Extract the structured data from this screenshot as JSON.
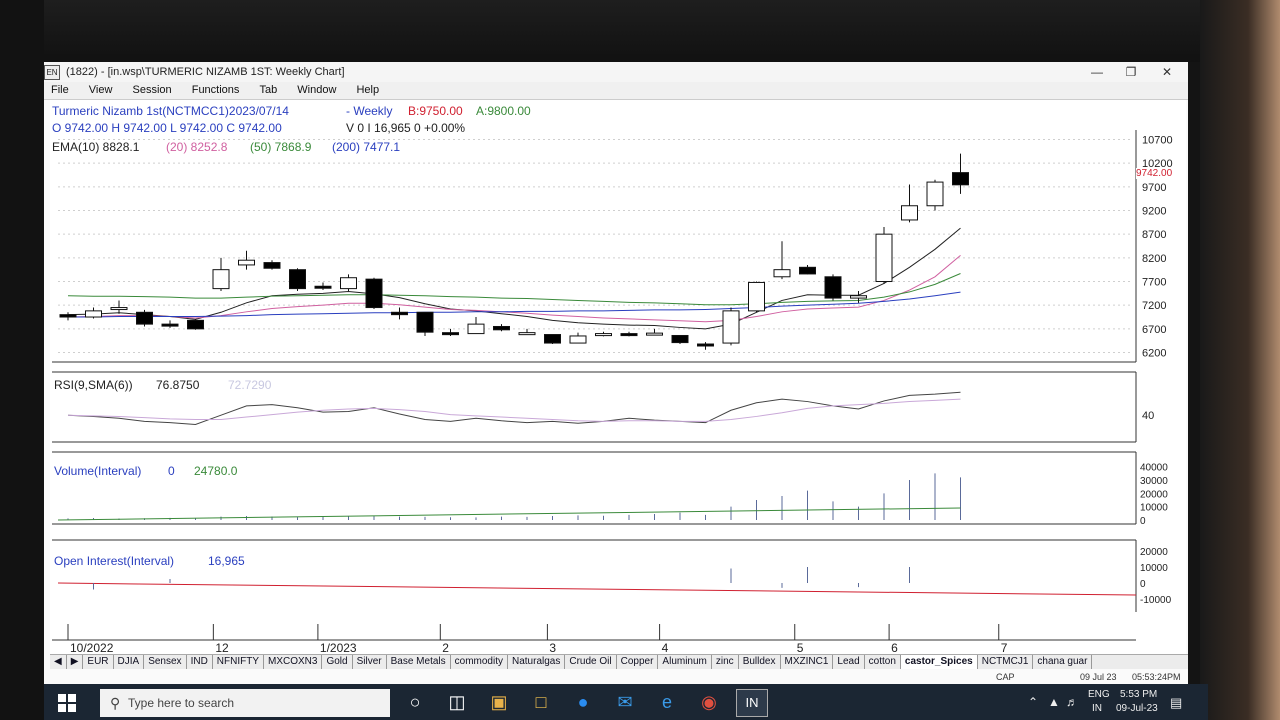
{
  "window": {
    "title": "(1822) - [in.wsp\\TURMERIC NIZAMB 1ST: Weekly Chart]",
    "app_icon_text": "EN",
    "menu": [
      "File",
      "View",
      "Session",
      "Functions",
      "Tab",
      "Window",
      "Help"
    ]
  },
  "quote": {
    "symbol": "Turmeric Nizamb 1st(NCTMCC1)2023/07/14",
    "period": "- Weekly",
    "bid": "B:9750.00",
    "ask": "A:9800.00",
    "ohlc": "O 9742.00 H 9742.00 L 9742.00 C 9742.00",
    "volume_oi": "V 0 I 16,965  0  +0.00%"
  },
  "ema": {
    "label": "EMA(10) 8828.1",
    "e20": "(20) 8252.8",
    "e50": "(50) 7868.9",
    "e200": "(200) 7477.1"
  },
  "panels": {
    "rsi_label": "RSI(9,SMA(6))",
    "rsi_value": "76.8750",
    "rsi_sma": "72.7290",
    "volume_label": "Volume(Interval)",
    "volume_value": "0",
    "volume_avg": "24780.0",
    "oi_label": "Open Interest(Interval)",
    "oi_value": "16,965",
    "last_price_tag": "9742.00"
  },
  "tabs": [
    "EUR",
    "DJIA",
    "Sensex",
    "IND",
    "NFNIFTY",
    "MXCOXN3",
    "Gold",
    "Silver",
    "Base Metals",
    "commodity",
    "Naturalgas",
    "Crude Oil",
    "Copper",
    "Aluminum",
    "zinc",
    "Bulldex",
    "MXZINC1",
    "Lead",
    "cotton",
    "castor_Spices",
    "NCTMCJ1",
    "chana guar"
  ],
  "active_tab": "castor_Spices",
  "status": {
    "cap": "CAP",
    "date": "09 Jul 23",
    "time": "05:53:24PM"
  },
  "taskbar": {
    "search_placeholder": "Type here to search",
    "lang": "ENG",
    "region": "IN",
    "clock_time": "5:53 PM",
    "clock_date": "09-Jul-23"
  },
  "colors": {
    "bull": "#ffffff",
    "bear": "#000000",
    "ema10": "#222222",
    "ema20": "#d060a0",
    "ema50": "#3a8a3a",
    "ema200": "#2a3fbf",
    "rsi": "#444444",
    "accent_red": "#d02030"
  },
  "chart_data": [
    {
      "type": "candlestick",
      "title": "Turmeric Nizamb 1st(NCTMCC1) Weekly",
      "x_labels": [
        "10/2022",
        "12",
        "1/2023",
        "2",
        "3",
        "4",
        "5",
        "6",
        "7"
      ],
      "y_ticks": [
        10700,
        10200,
        9700,
        9200,
        8700,
        8200,
        7700,
        7200,
        6700,
        6200
      ],
      "ylim": [
        6000,
        10900
      ],
      "candles": [
        {
          "o": 7000,
          "h": 7050,
          "l": 6880,
          "c": 6950
        },
        {
          "o": 6950,
          "h": 7150,
          "l": 6920,
          "c": 7080
        },
        {
          "o": 7120,
          "h": 7300,
          "l": 7020,
          "c": 7150
        },
        {
          "o": 7050,
          "h": 7100,
          "l": 6750,
          "c": 6800
        },
        {
          "o": 6800,
          "h": 6880,
          "l": 6720,
          "c": 6790
        },
        {
          "o": 6880,
          "h": 6900,
          "l": 6680,
          "c": 6700
        },
        {
          "o": 7550,
          "h": 8200,
          "l": 7500,
          "c": 7950
        },
        {
          "o": 8050,
          "h": 8350,
          "l": 7950,
          "c": 8150
        },
        {
          "o": 8100,
          "h": 8150,
          "l": 7950,
          "c": 7980
        },
        {
          "o": 7950,
          "h": 7980,
          "l": 7500,
          "c": 7550
        },
        {
          "o": 7600,
          "h": 7680,
          "l": 7520,
          "c": 7560
        },
        {
          "o": 7550,
          "h": 7850,
          "l": 7500,
          "c": 7780
        },
        {
          "o": 7750,
          "h": 7780,
          "l": 7120,
          "c": 7150
        },
        {
          "o": 7050,
          "h": 7150,
          "l": 6900,
          "c": 7000
        },
        {
          "o": 7050,
          "h": 7050,
          "l": 6550,
          "c": 6630
        },
        {
          "o": 6620,
          "h": 6700,
          "l": 6550,
          "c": 6610
        },
        {
          "o": 6600,
          "h": 6950,
          "l": 6600,
          "c": 6800
        },
        {
          "o": 6750,
          "h": 6800,
          "l": 6650,
          "c": 6680
        },
        {
          "o": 6620,
          "h": 6700,
          "l": 6600,
          "c": 6620
        },
        {
          "o": 6580,
          "h": 6580,
          "l": 6380,
          "c": 6400
        },
        {
          "o": 6400,
          "h": 6620,
          "l": 6400,
          "c": 6550
        },
        {
          "o": 6580,
          "h": 6640,
          "l": 6540,
          "c": 6600
        },
        {
          "o": 6600,
          "h": 6640,
          "l": 6540,
          "c": 6570
        },
        {
          "o": 6600,
          "h": 6700,
          "l": 6560,
          "c": 6610
        },
        {
          "o": 6560,
          "h": 6560,
          "l": 6380,
          "c": 6410
        },
        {
          "o": 6380,
          "h": 6420,
          "l": 6260,
          "c": 6350
        },
        {
          "o": 6400,
          "h": 7150,
          "l": 6350,
          "c": 7080
        },
        {
          "o": 7080,
          "h": 7700,
          "l": 7050,
          "c": 7680
        },
        {
          "o": 7800,
          "h": 8550,
          "l": 7750,
          "c": 7950
        },
        {
          "o": 8000,
          "h": 8050,
          "l": 7850,
          "c": 7860
        },
        {
          "o": 7800,
          "h": 7850,
          "l": 7300,
          "c": 7350
        },
        {
          "o": 7350,
          "h": 7500,
          "l": 7250,
          "c": 7400
        },
        {
          "o": 7700,
          "h": 8850,
          "l": 7650,
          "c": 8700
        },
        {
          "o": 9000,
          "h": 9750,
          "l": 8950,
          "c": 9300
        },
        {
          "o": 9300,
          "h": 9850,
          "l": 9200,
          "c": 9800
        },
        {
          "o": 10000,
          "h": 10400,
          "l": 9550,
          "c": 9742
        }
      ],
      "series": [
        {
          "name": "EMA(10)",
          "values": [
            7000,
            7010,
            7040,
            7000,
            6960,
            6900,
            7050,
            7250,
            7400,
            7430,
            7450,
            7490,
            7440,
            7360,
            7230,
            7120,
            7080,
            7020,
            6960,
            6880,
            6830,
            6800,
            6780,
            6770,
            6730,
            6700,
            6800,
            7050,
            7300,
            7420,
            7410,
            7410,
            7660,
            8000,
            8380,
            8828
          ]
        },
        {
          "name": "EMA(20)",
          "values": [
            6950,
            6960,
            6980,
            6980,
            6960,
            6930,
            6980,
            7060,
            7130,
            7170,
            7200,
            7240,
            7240,
            7210,
            7160,
            7110,
            7090,
            7060,
            7030,
            6990,
            6960,
            6930,
            6910,
            6890,
            6870,
            6850,
            6880,
            6960,
            7060,
            7120,
            7140,
            7160,
            7300,
            7520,
            7800,
            8253
          ]
        },
        {
          "name": "EMA(50)",
          "values": [
            7400,
            7390,
            7390,
            7380,
            7370,
            7350,
            7350,
            7370,
            7390,
            7400,
            7410,
            7420,
            7420,
            7410,
            7400,
            7380,
            7370,
            7350,
            7340,
            7320,
            7300,
            7280,
            7260,
            7250,
            7230,
            7210,
            7210,
            7230,
            7260,
            7280,
            7290,
            7300,
            7370,
            7480,
            7640,
            7869
          ]
        },
        {
          "name": "EMA(200)",
          "values": [
            6950,
            6950,
            6960,
            6960,
            6960,
            6960,
            6970,
            6980,
            7000,
            7010,
            7020,
            7030,
            7040,
            7040,
            7050,
            7050,
            7060,
            7060,
            7070,
            7070,
            7080,
            7080,
            7090,
            7100,
            7100,
            7110,
            7130,
            7150,
            7180,
            7200,
            7220,
            7240,
            7280,
            7330,
            7400,
            7477
          ]
        }
      ]
    },
    {
      "type": "line",
      "title": "RSI(9,SMA(6))",
      "y_ticks": [
        40
      ],
      "ylim": [
        0,
        100
      ],
      "series": [
        {
          "name": "RSI",
          "values": [
            40,
            38,
            35,
            30,
            28,
            25,
            40,
            55,
            57,
            52,
            45,
            46,
            52,
            42,
            33,
            30,
            35,
            31,
            28,
            30,
            27,
            30,
            35,
            32,
            30,
            28,
            48,
            60,
            66,
            62,
            55,
            50,
            63,
            72,
            74,
            77
          ]
        },
        {
          "name": "SMA(6)",
          "values": [
            40,
            39,
            38,
            36,
            34,
            33,
            33,
            37,
            41,
            45,
            48,
            50,
            51,
            49,
            46,
            41,
            39,
            37,
            35,
            33,
            31,
            30,
            31,
            31,
            30,
            30,
            33,
            38,
            44,
            51,
            55,
            57,
            59,
            62,
            64,
            66
          ]
        }
      ]
    },
    {
      "type": "bar",
      "title": "Volume(Interval)",
      "y_ticks": [
        40000,
        30000,
        20000,
        10000,
        0
      ],
      "ylim": [
        0,
        45000
      ],
      "values": [
        1200,
        1500,
        1100,
        1300,
        1600,
        1400,
        2500,
        3000,
        2600,
        2200,
        2400,
        2800,
        3200,
        2500,
        2300,
        2100,
        2000,
        2500,
        2300,
        3000,
        3500,
        3200,
        3800,
        4500,
        5500,
        3800,
        10000,
        15000,
        18000,
        22000,
        14000,
        10000,
        20000,
        30000,
        35000,
        32000,
        40000,
        0
      ]
    },
    {
      "type": "bar",
      "title": "Open Interest(Interval)",
      "y_ticks": [
        20000,
        10000,
        0,
        -10000
      ],
      "ylim": [
        -13000,
        23000
      ],
      "values": [
        0,
        -4000,
        0,
        0,
        2500,
        0,
        0,
        0,
        0,
        0,
        0,
        0,
        0,
        0,
        0,
        0,
        0,
        0,
        0,
        0,
        0,
        0,
        0,
        0,
        0,
        0,
        9000,
        0,
        -3000,
        10000,
        0,
        -2500,
        0,
        10000,
        0,
        0,
        16965
      ]
    }
  ]
}
